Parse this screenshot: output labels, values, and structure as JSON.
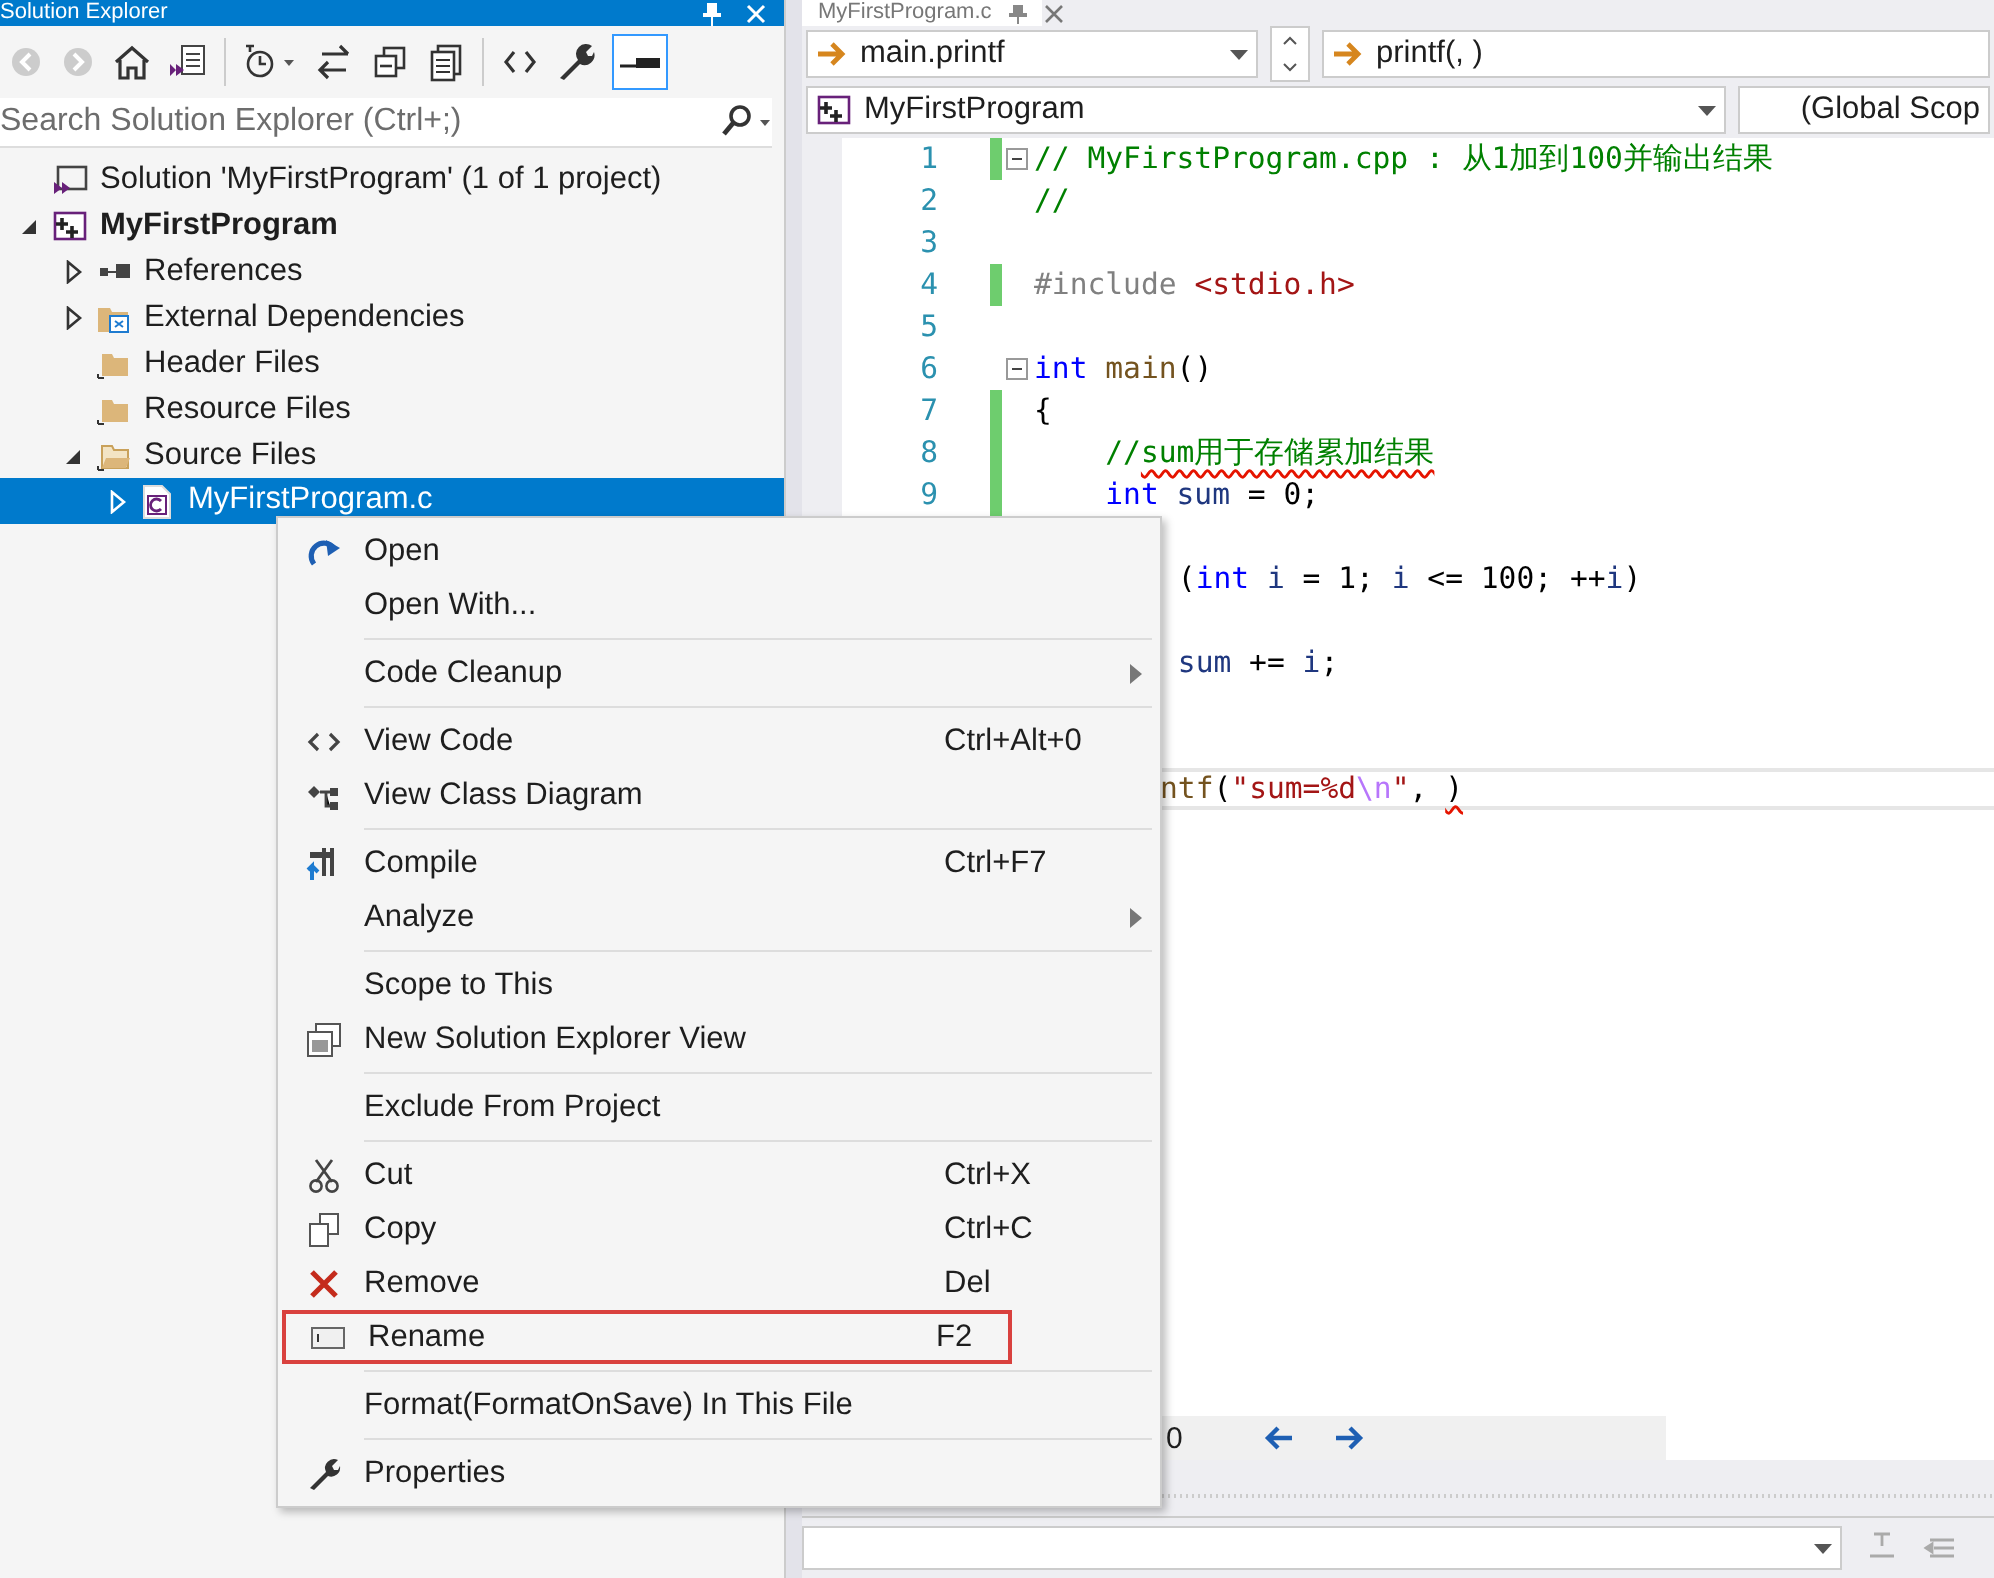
{
  "explorer": {
    "title": "Solution Explorer",
    "search": {
      "placeholder": "Search Solution Explorer (Ctrl+;)"
    },
    "tree": [
      {
        "label": "Solution 'MyFirstProgram' (1 of 1 project)",
        "kind": "solution",
        "selected": false,
        "children": [
          {
            "label": "MyFirstProgram",
            "kind": "project",
            "expanded": true,
            "selected": false,
            "children": [
              {
                "label": "References",
                "expanded": false,
                "selected": false
              },
              {
                "label": "External Dependencies",
                "expanded": false,
                "selected": false
              },
              {
                "label": "Header Files",
                "selected": false
              },
              {
                "label": "Resource Files",
                "selected": false
              },
              {
                "label": "Source Files",
                "expanded": true,
                "selected": false,
                "children": [
                  {
                    "label": "MyFirstProgram.c",
                    "expanded": false,
                    "selected": true
                  }
                ]
              }
            ]
          }
        ]
      }
    ]
  },
  "editor": {
    "tab": {
      "label": "MyFirstProgram.c"
    },
    "nav": {
      "member": "main.printf",
      "function": "printf(, )",
      "project": "MyFirstProgram",
      "scope": "(Global Scop"
    },
    "lines": [
      {
        "number": "1",
        "kind": "full",
        "changed": true,
        "fold": true,
        "current": false,
        "segments": [
          {
            "text": "// MyFirstProgram.cpp : 从1加到100并输出结果",
            "kind": "comment"
          }
        ]
      },
      {
        "number": "2",
        "kind": "full",
        "changed": false,
        "fold": false,
        "current": false,
        "segments": [
          {
            "text": "//",
            "kind": "comment"
          }
        ]
      },
      {
        "number": "3",
        "kind": "full",
        "changed": false,
        "fold": false,
        "current": false
      },
      {
        "number": "4",
        "kind": "full",
        "changed": true,
        "fold": false,
        "current": false,
        "segments": [
          {
            "text": "#include ",
            "kind": "pre"
          },
          {
            "text": "<stdio.h>",
            "kind": "str"
          }
        ]
      },
      {
        "number": "5",
        "kind": "full",
        "changed": false,
        "fold": false,
        "current": false
      },
      {
        "number": "6",
        "kind": "full",
        "changed": false,
        "fold": true,
        "current": false,
        "segments": [
          {
            "text": "int",
            "kind": "kw"
          },
          {
            "text": " main",
            "kind": "func"
          },
          {
            "text": "()",
            "kind": "plain"
          }
        ]
      },
      {
        "number": "7",
        "kind": "full",
        "changed": true,
        "fold": false,
        "current": false,
        "segments": [
          {
            "text": "{",
            "kind": "plain"
          }
        ]
      },
      {
        "number": "8",
        "kind": "full",
        "changed": true,
        "fold": false,
        "current": false,
        "segments": [
          {
            "text": "    //",
            "kind": "comment"
          },
          {
            "text": "sum用于存储累加结果",
            "kind": "comment-err"
          }
        ]
      },
      {
        "number": "9",
        "kind": "full",
        "changed": true,
        "fold": false,
        "current": false,
        "segments": [
          {
            "text": "    int",
            "kind": "kw"
          },
          {
            "text": " sum",
            "kind": "var"
          },
          {
            "text": " = 0;",
            "kind": "plain"
          }
        ]
      },
      {
        "kind": "covered"
      },
      {
        "kind": "partial",
        "current": false,
        "segments": [
          {
            "text": " (",
            "kind": "plain"
          },
          {
            "text": "int",
            "kind": "kw"
          },
          {
            "text": " i",
            "kind": "var"
          },
          {
            "text": " = 1; ",
            "kind": "plain"
          },
          {
            "text": "i",
            "kind": "var"
          },
          {
            "text": " <= 100; ++",
            "kind": "plain"
          },
          {
            "text": "i",
            "kind": "var"
          },
          {
            "text": ")",
            "kind": "plain"
          }
        ]
      },
      {
        "kind": "covered"
      },
      {
        "kind": "partial",
        "current": false,
        "segments": [
          {
            "text": " sum",
            "kind": "var"
          },
          {
            "text": " += ",
            "kind": "plain"
          },
          {
            "text": "i",
            "kind": "var"
          },
          {
            "text": ";",
            "kind": "plain"
          }
        ]
      },
      {
        "kind": "covered"
      },
      {
        "kind": "covered"
      },
      {
        "kind": "partial",
        "current": true,
        "segments": [
          {
            "text": "ntf",
            "kind": "func"
          },
          {
            "text": "(",
            "kind": "plain"
          },
          {
            "text": "\"sum=%d",
            "kind": "str"
          },
          {
            "text": "\\n",
            "kind": "esc"
          },
          {
            "text": "\"",
            "kind": "str"
          },
          {
            "text": ", ",
            "kind": "plain"
          },
          {
            "text": ")",
            "kind": "plain-err"
          }
        ]
      }
    ],
    "status": {
      "count": "0"
    }
  },
  "context_menu": {
    "groups": [
      [
        {
          "label": "Open",
          "submenu": false,
          "outlined": false
        },
        {
          "label": "Open With...",
          "submenu": false,
          "outlined": false
        }
      ],
      [
        {
          "label": "Code Cleanup",
          "submenu": true,
          "outlined": false
        }
      ],
      [
        {
          "label": "View Code",
          "shortcut": "Ctrl+Alt+0",
          "submenu": false,
          "outlined": false
        },
        {
          "label": "View Class Diagram",
          "submenu": false,
          "outlined": false
        }
      ],
      [
        {
          "label": "Compile",
          "shortcut": "Ctrl+F7",
          "submenu": false,
          "outlined": false
        },
        {
          "label": "Analyze",
          "submenu": true,
          "outlined": false
        }
      ],
      [
        {
          "label": "Scope to This",
          "submenu": false,
          "outlined": false
        },
        {
          "label": "New Solution Explorer View",
          "submenu": false,
          "outlined": false
        }
      ],
      [
        {
          "label": "Exclude From Project",
          "submenu": false,
          "outlined": false
        }
      ],
      [
        {
          "label": "Cut",
          "shortcut": "Ctrl+X",
          "submenu": false,
          "outlined": false
        },
        {
          "label": "Copy",
          "shortcut": "Ctrl+C",
          "submenu": false,
          "outlined": false
        },
        {
          "label": "Remove",
          "shortcut": "Del",
          "submenu": false,
          "outlined": false
        },
        {
          "label": "Rename",
          "shortcut": "F2",
          "submenu": false,
          "outlined": true
        }
      ],
      [
        {
          "label": "Format(FormatOnSave) In This File",
          "submenu": false,
          "outlined": false
        }
      ],
      [
        {
          "label": "Properties",
          "submenu": false,
          "outlined": false
        }
      ]
    ]
  }
}
